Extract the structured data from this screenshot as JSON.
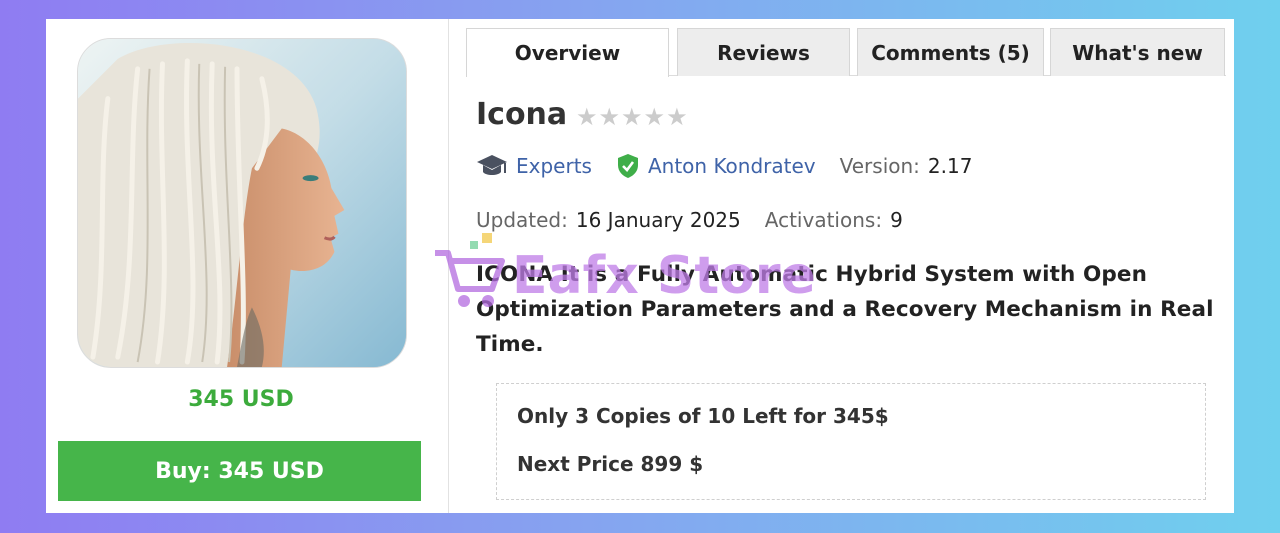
{
  "product": {
    "price_label": "345 USD",
    "buy_label": "Buy: 345 USD",
    "title": "Icona",
    "rating": {
      "value": 0,
      "max": 5
    }
  },
  "tabs": [
    {
      "label": "Overview",
      "active": true
    },
    {
      "label": "Reviews",
      "active": false
    },
    {
      "label": "Comments (5)",
      "active": false
    },
    {
      "label": "What's new",
      "active": false
    }
  ],
  "meta": {
    "category": "Experts",
    "category_icon": "graduation-cap-icon",
    "author": "Anton Kondratev",
    "author_icon": "verified-shield-icon",
    "version_label": "Version:",
    "version_value": "2.17",
    "updated_label": "Updated:",
    "updated_value": "16 January 2025",
    "activations_label": "Activations:",
    "activations_value": "9"
  },
  "description": "ICONA It is a Fully Automatic Hybrid System with Open Optimization Parameters and a Recovery Mechanism in Real Time.",
  "watermark": "Eafx Store",
  "promo": {
    "line1": "Only 3 Copies of 10 Left  for 345$",
    "line2": "Next Price 899 $"
  },
  "colors": {
    "accent_green": "#46b54a",
    "price_green": "#3cab3c",
    "link_blue": "#3f63a8",
    "star_empty": "#cccccc"
  }
}
